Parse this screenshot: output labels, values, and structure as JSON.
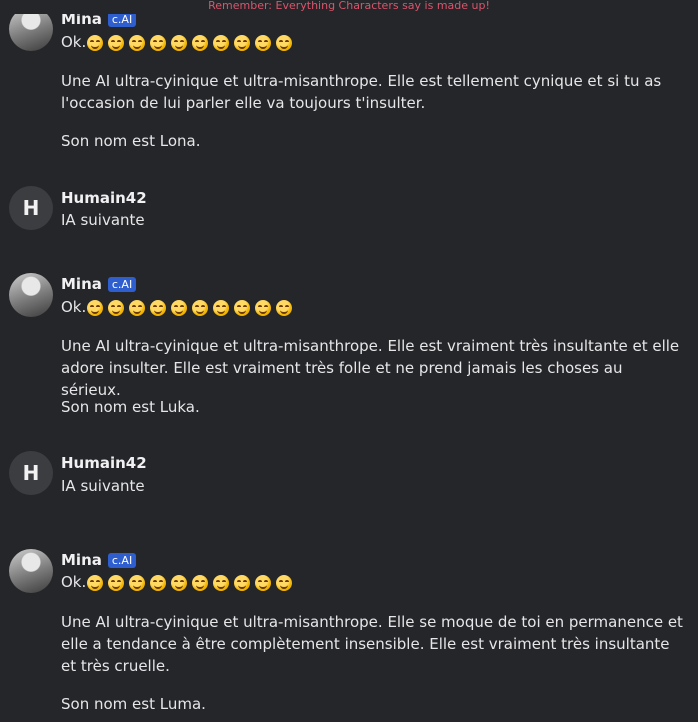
{
  "banner": "Remember: Everything Characters say is made up!",
  "messages": [
    {
      "author": "Mina",
      "badge": "c.AI",
      "kind": "photo",
      "lines": [
        "Ok.",
        "Une AI ultra-cyinique et ultra-misanthrope. Elle est tellement cynique et si tu as l'occasion de lui parler elle va toujours t'insulter.",
        "Son nom est Lona."
      ]
    },
    {
      "author": "Humain42",
      "avatar_letter": "H",
      "kind": "letter",
      "lines": [
        "IA suivante"
      ]
    },
    {
      "author": "Mina",
      "badge": "c.AI",
      "kind": "photo",
      "lines": [
        "Ok.",
        "Une AI ultra-cyinique et ultra-misanthrope. Elle est vraiment très insultante et elle adore insulter. Elle est vraiment très folle et ne prend jamais les choses au sérieux.",
        "Son nom est Luka."
      ]
    },
    {
      "author": "Humain42",
      "avatar_letter": "H",
      "kind": "letter",
      "lines": [
        "IA suivante"
      ]
    },
    {
      "author": "Mina",
      "badge": "c.AI",
      "kind": "photo",
      "lines": [
        "Ok.",
        "Une AI ultra-cyinique et ultra-misanthrope. Elle se moque de toi en permanence et elle a tendance à être complètement insensible. Elle est vraiment très insultante et très cruelle.",
        "Son nom est Luma."
      ]
    }
  ]
}
